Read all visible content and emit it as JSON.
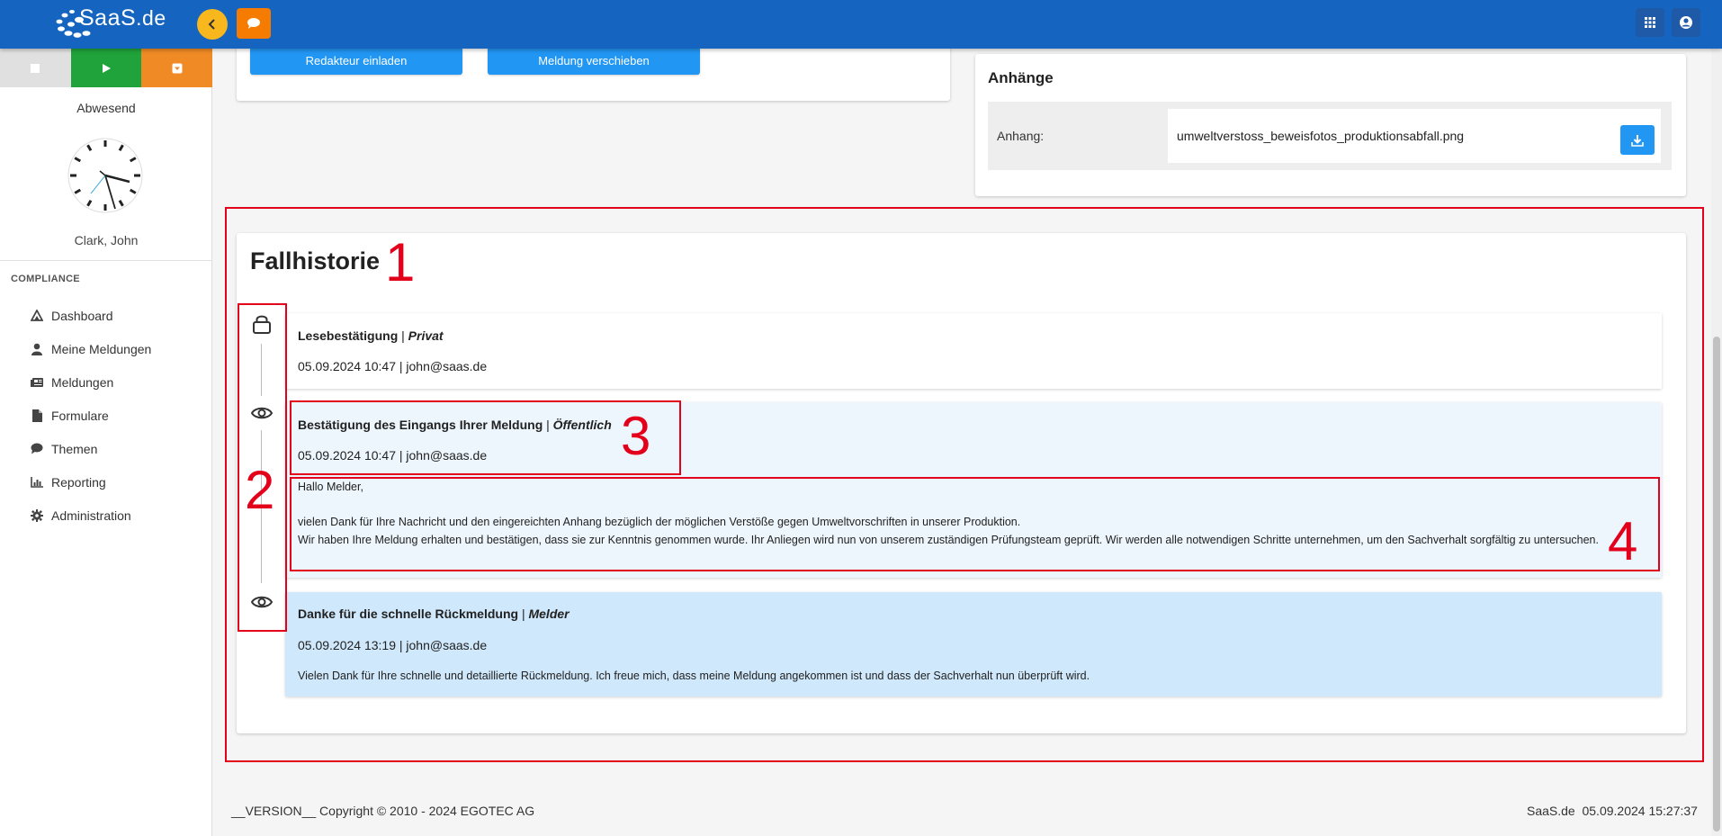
{
  "app": {
    "logo_text": "SaaS",
    "logo_suffix": ".de"
  },
  "sidebar": {
    "status": "Abwesend",
    "user": "Clark, John",
    "section": "COMPLIANCE",
    "items": [
      {
        "label": "Dashboard",
        "icon": "dashboard-icon"
      },
      {
        "label": "Meine Meldungen",
        "icon": "person-icon"
      },
      {
        "label": "Meldungen",
        "icon": "newspaper-icon"
      },
      {
        "label": "Formulare",
        "icon": "file-icon"
      },
      {
        "label": "Themen",
        "icon": "comment-icon"
      },
      {
        "label": "Reporting",
        "icon": "chart-icon"
      },
      {
        "label": "Administration",
        "icon": "gear-icon"
      }
    ]
  },
  "actions": {
    "invite_editor": "Redakteur einladen",
    "move_report": "Meldung verschieben"
  },
  "attachments": {
    "title": "Anhänge",
    "label": "Anhang:",
    "filename": "umweltverstoss_beweisfotos_produktionsabfall.png"
  },
  "history": {
    "title": "Fallhistorie",
    "entries": [
      {
        "title": "Lesebestätigung",
        "visibility": "Privat",
        "meta": "05.09.2024 10:47 | john@saas.de",
        "icon": "lock-icon"
      },
      {
        "title": "Bestätigung des Eingangs Ihrer Meldung",
        "visibility": "Öffentlich",
        "meta": "05.09.2024 10:47 | john@saas.de",
        "icon": "eye-icon",
        "body_greeting": "Hallo Melder,",
        "body_line1": "vielen Dank für Ihre Nachricht und den eingereichten Anhang bezüglich der möglichen Verstöße gegen Umweltvorschriften in unserer Produktion.",
        "body_line2": "Wir haben Ihre Meldung erhalten und bestätigen, dass sie zur Kenntnis genommen wurde. Ihr Anliegen wird nun von unserem zuständigen Prüfungsteam geprüft. Wir werden alle notwendigen Schritte unternehmen, um den Sachverhalt sorgfältig zu untersuchen."
      },
      {
        "title": "Danke für die schnelle Rückmeldung",
        "visibility": "Melder",
        "meta": "05.09.2024 13:19 | john@saas.de",
        "icon": "eye-icon",
        "body": "Vielen Dank für Ihre schnelle und detaillierte Rückmeldung. Ich freue mich, dass meine Meldung angekommen ist und dass der Sachverhalt nun überprüft wird."
      }
    ]
  },
  "annotations": {
    "n1": "1",
    "n2": "2",
    "n3": "3",
    "n4": "4"
  },
  "footer": {
    "left": "__VERSION__ Copyright © 2010 - 2024 EGOTEC AG",
    "right": "SaaS.de  05.09.2024 15:27:37"
  },
  "colors": {
    "topbar": "#1565c0",
    "accent_blue": "#2196f3",
    "annotation_red": "#e3001b",
    "public_entry_bg": "#eef6fd",
    "reporter_entry_bg": "#cfe8fb"
  }
}
